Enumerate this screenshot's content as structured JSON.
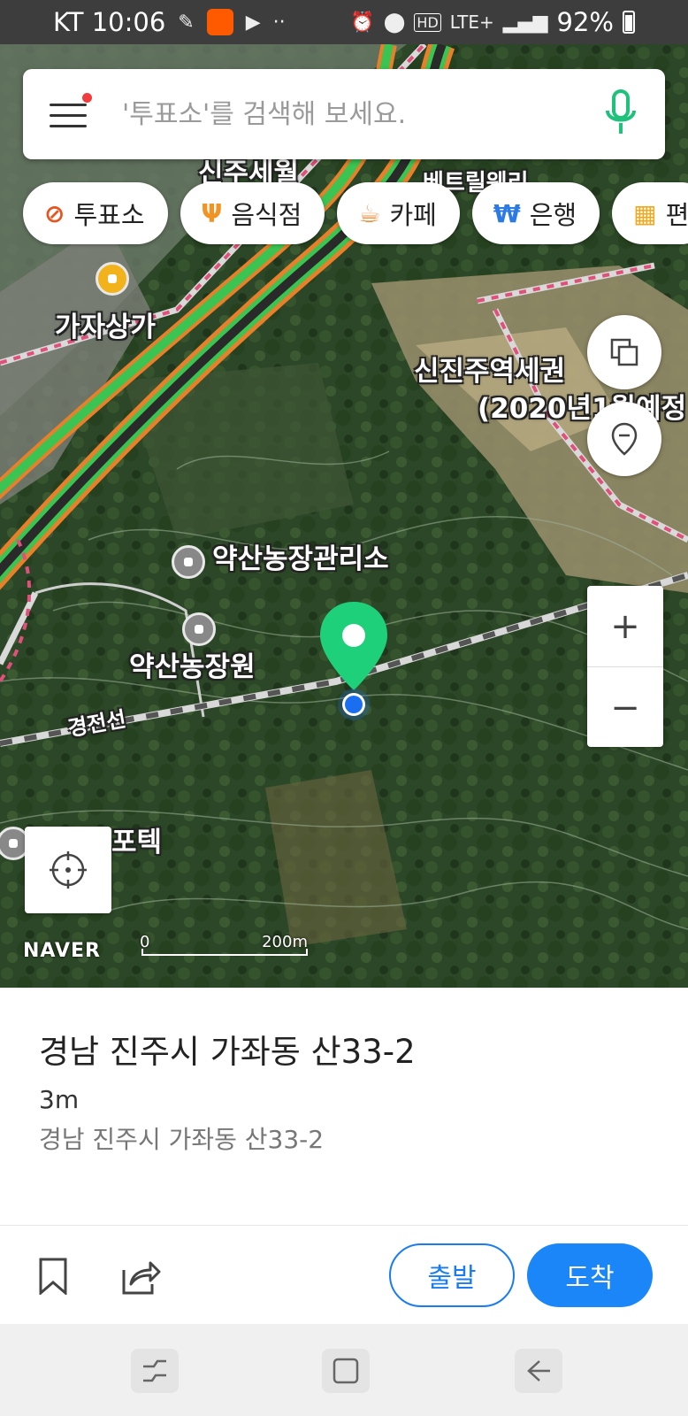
{
  "status_bar": {
    "carrier_time": "KT 10:06",
    "network": "LTE+",
    "battery": "92%"
  },
  "search": {
    "placeholder": "'투표소'를 검색해 보세요.",
    "menu_icon": "hamburger-menu-icon",
    "voice_icon": "microphone-icon",
    "accent_color": "#1ec27a"
  },
  "categories": [
    {
      "label": "투표소",
      "icon": "vote-icon",
      "color": "#e8531f"
    },
    {
      "label": "음식점",
      "icon": "fork-knife-icon",
      "color": "#f29424"
    },
    {
      "label": "카페",
      "icon": "coffee-cup-icon",
      "color": "#f28a34"
    },
    {
      "label": "은행",
      "icon": "won-icon",
      "color": "#2c7be5"
    },
    {
      "label": "편",
      "icon": "store-icon",
      "color": "#f2a81d"
    }
  ],
  "map_labels": {
    "gajasangga": "가자상가",
    "sinjin": "신진주역세권",
    "sinjin2": "(2020년1월예정",
    "yaksan_office": "약산농장관리소",
    "yaksan_farm": "약산농장원",
    "rail_line": "경전선",
    "potek": "포텍",
    "top_left": "신주세월",
    "top_right": "베트릴웨리"
  },
  "map_controls": {
    "zoom_in": "+",
    "zoom_out": "−",
    "layers_icon": "layers-icon",
    "location_pin_icon": "map-pin-icon",
    "current_location_icon": "crosshair-icon"
  },
  "map_footer": {
    "brand": "NAVER",
    "scale_start": "0",
    "scale_end": "200m"
  },
  "place": {
    "title": "경남 진주시 가좌동 산33-2",
    "distance": "3m",
    "address": "경남 진주시 가좌동 산33-2",
    "pin_color": "#1fd07a",
    "location_dot_color": "#1a6ef0"
  },
  "actions": {
    "bookmark_icon": "bookmark-icon",
    "share_icon": "share-icon",
    "depart_label": "출발",
    "arrive_label": "도착",
    "primary_color": "#1a86f7"
  },
  "nav_bar": {
    "recent_icon": "recent-apps-icon",
    "home_icon": "home-icon",
    "back_icon": "back-icon"
  }
}
